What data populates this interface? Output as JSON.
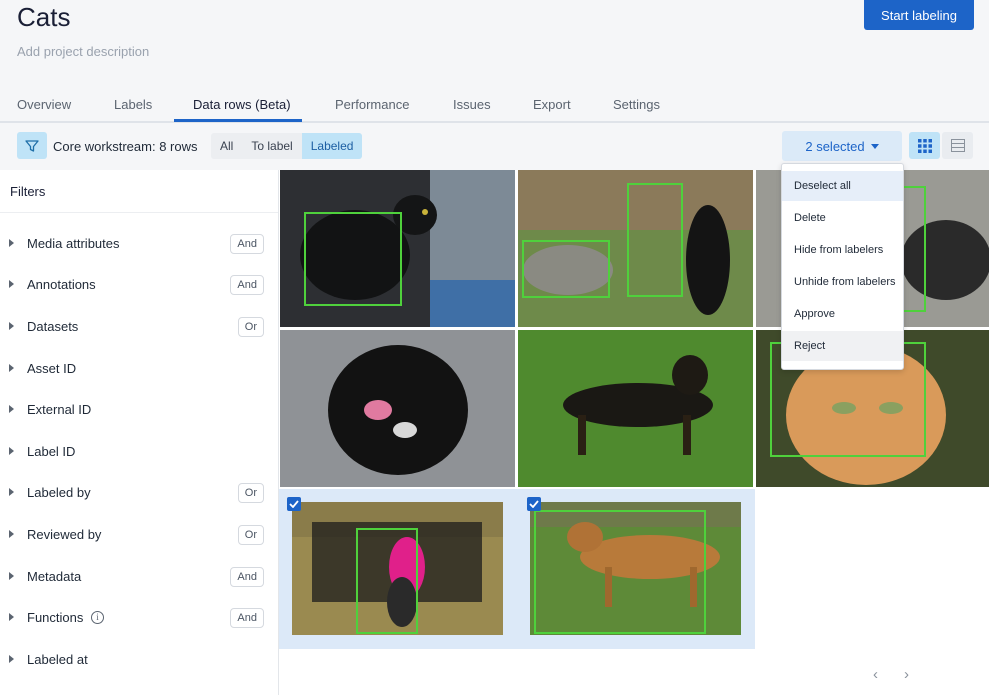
{
  "project": {
    "title": "Cats",
    "description_placeholder": "Add project description",
    "start_button": "Start labeling"
  },
  "tabs": [
    "Overview",
    "Labels",
    "Data rows (Beta)",
    "Performance",
    "Issues",
    "Export",
    "Settings"
  ],
  "active_tab": "Data rows (Beta)",
  "toolbar": {
    "workstream": "Core workstream: 8 rows",
    "segments": [
      "All",
      "To label",
      "Labeled"
    ],
    "active_segment": "Labeled",
    "selected_label": "2 selected",
    "accent": "#1d64c8"
  },
  "filters": {
    "title": "Filters",
    "items": [
      {
        "label": "Media attributes",
        "badge": "And"
      },
      {
        "label": "Annotations",
        "badge": "And"
      },
      {
        "label": "Datasets",
        "badge": "Or"
      },
      {
        "label": "Asset ID",
        "badge": ""
      },
      {
        "label": "External ID",
        "badge": ""
      },
      {
        "label": "Label ID",
        "badge": ""
      },
      {
        "label": "Labeled by",
        "badge": "Or"
      },
      {
        "label": "Reviewed by",
        "badge": "Or"
      },
      {
        "label": "Metadata",
        "badge": "And"
      },
      {
        "label": "Functions",
        "badge": "And"
      },
      {
        "label": "Labeled at",
        "badge": ""
      }
    ]
  },
  "menu": {
    "items": [
      "Deselect all",
      "Delete",
      "Hide from labelers",
      "Unhide from labelers",
      "Approve",
      "Reject"
    ]
  },
  "pager": {
    "prev": "‹",
    "next": "›"
  }
}
